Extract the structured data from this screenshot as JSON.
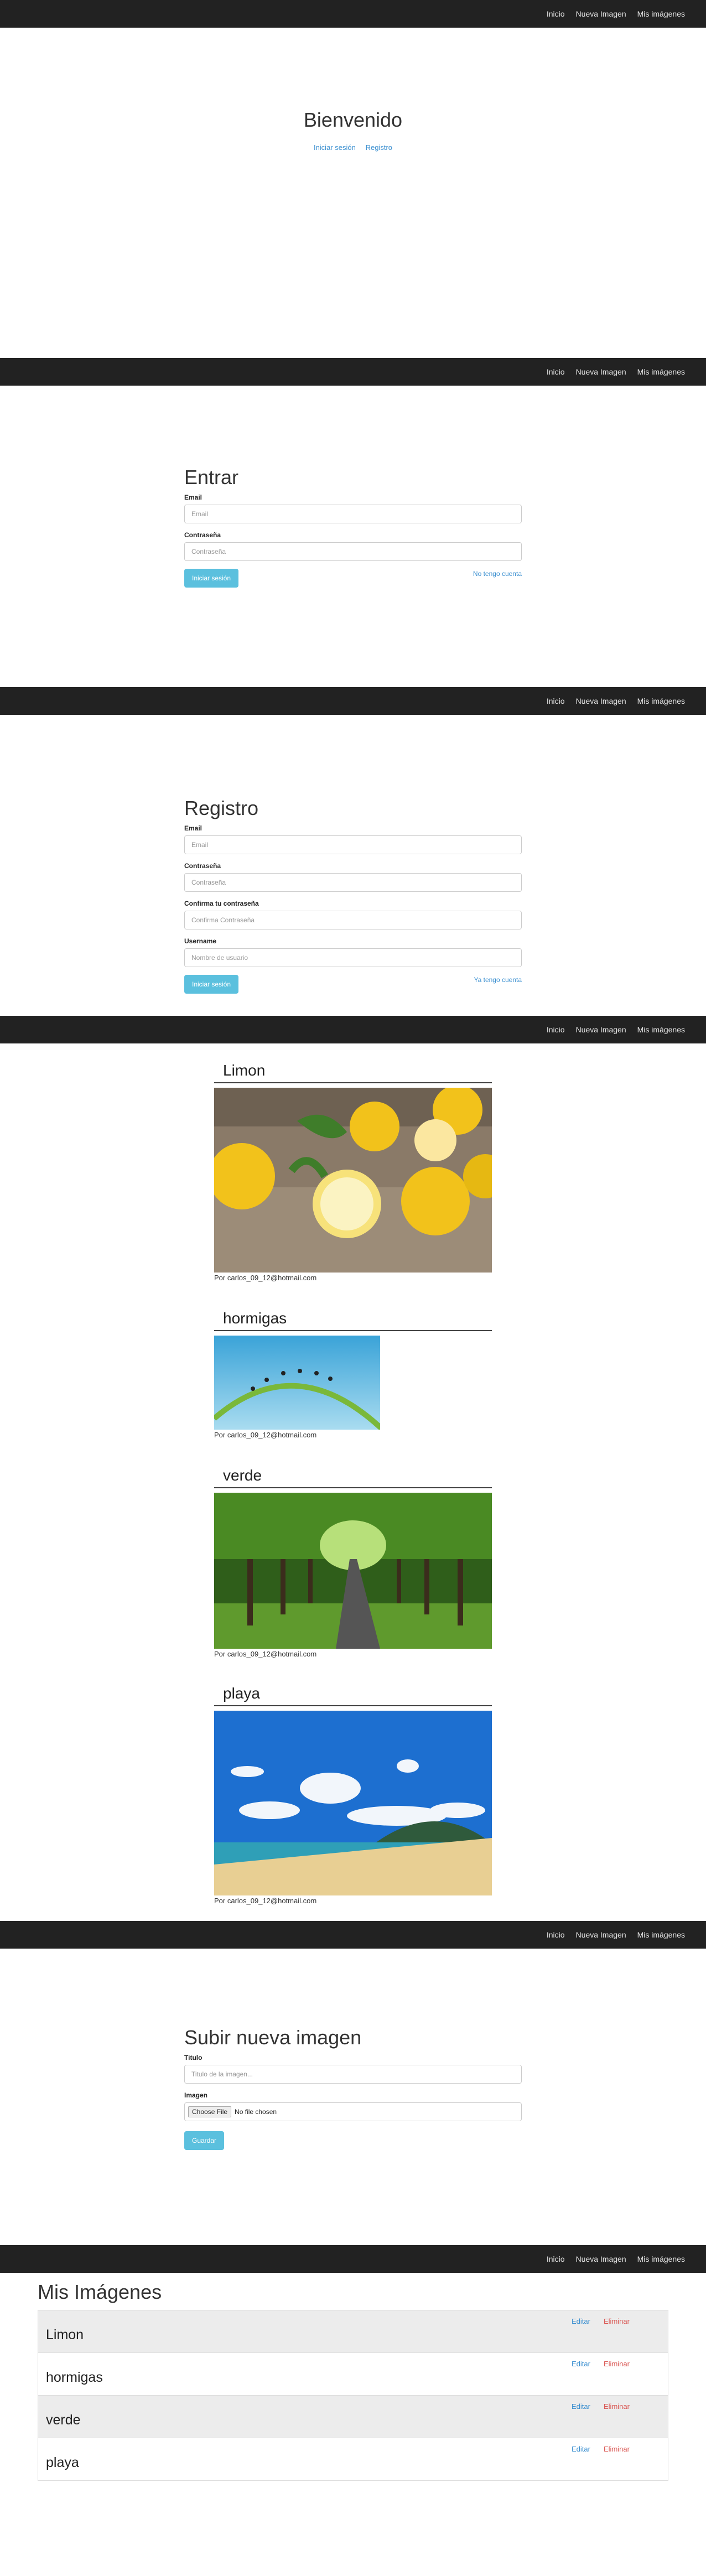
{
  "nav": {
    "inicio": "Inicio",
    "nueva": "Nueva Imagen",
    "mis": "Mis imágenes"
  },
  "home": {
    "title": "Bienvenido",
    "login_link": "Iniciar sesión",
    "register_link": "Registro"
  },
  "login": {
    "title": "Entrar",
    "email_label": "Email",
    "email_placeholder": "Email",
    "password_label": "Contraseña",
    "password_placeholder": "Contraseña",
    "submit": "Iniciar sesión",
    "no_account": "No tengo cuenta"
  },
  "register": {
    "title": "Registro",
    "email_label": "Email",
    "email_placeholder": "Email",
    "password_label": "Contraseña",
    "password_placeholder": "Contraseña",
    "confirm_label": "Confirma tu contraseña",
    "confirm_placeholder": "Confirma Contraseña",
    "username_label": "Username",
    "username_placeholder": "Nombre de usuario",
    "submit": "Iniciar sesión",
    "have_account": "Ya tengo cuenta"
  },
  "feed": {
    "posts": [
      {
        "title": "Limon",
        "author": "Por carlos_09_12@hotmail.com"
      },
      {
        "title": "hormigas",
        "author": "Por carlos_09_12@hotmail.com"
      },
      {
        "title": "verde",
        "author": "Por carlos_09_12@hotmail.com"
      },
      {
        "title": "playa",
        "author": "Por carlos_09_12@hotmail.com"
      }
    ]
  },
  "upload": {
    "title": "Subir nueva imagen",
    "titulo_label": "Titulo",
    "titulo_placeholder": "Titulo de la imagen...",
    "imagen_label": "Imagen",
    "choose": "Choose File",
    "no_file": "No file chosen",
    "submit": "Guardar"
  },
  "mine": {
    "title": "Mis Imágenes",
    "edit": "Editar",
    "delete": "Eliminar",
    "items": [
      "Limon",
      "hormigas",
      "verde",
      "playa"
    ]
  },
  "colors": {
    "nav": "#222222",
    "accent": "#5bc0de",
    "link": "#3a8fd0",
    "danger": "#d9534f"
  }
}
